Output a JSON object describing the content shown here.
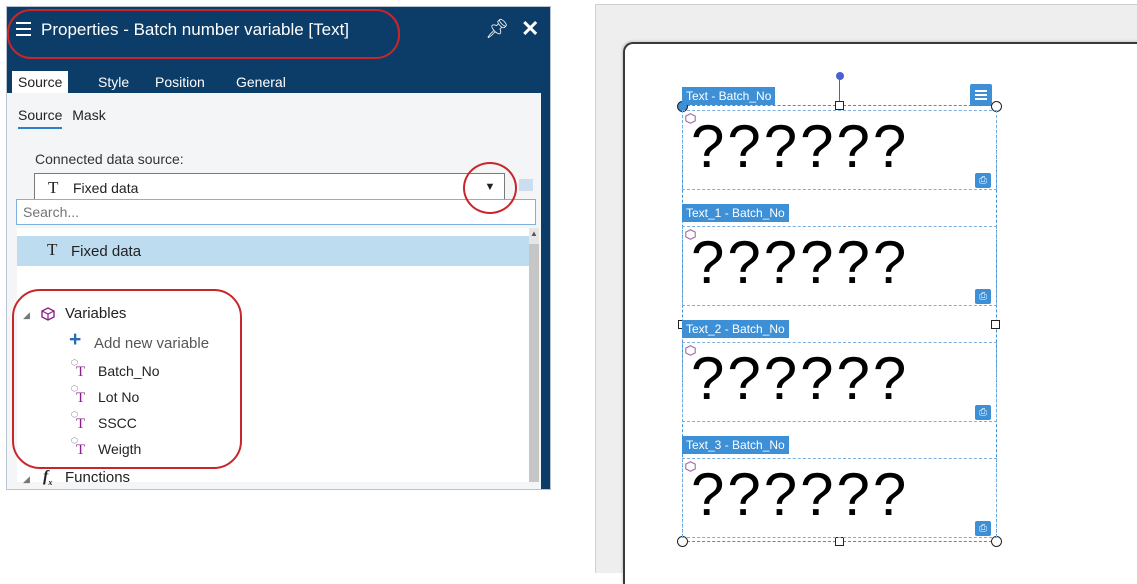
{
  "panel": {
    "title": "Properties - Batch number variable [Text]",
    "tabs": [
      {
        "label": "Source",
        "active": true
      },
      {
        "label": "Style",
        "active": false
      },
      {
        "label": "Position",
        "active": false
      },
      {
        "label": "General",
        "active": false
      }
    ],
    "subtabs": [
      {
        "label": "Source",
        "active": true
      },
      {
        "label": "Mask",
        "active": false
      }
    ],
    "connected_label": "Connected data source:",
    "selected_source": "Fixed data",
    "search_placeholder": "Search...",
    "list": {
      "selected_item": "Fixed data",
      "variables_group": "Variables",
      "add_variable": "Add new variable",
      "variables": [
        "Batch_No",
        "Lot No",
        "SSCC",
        "Weigth"
      ],
      "functions_group": "Functions"
    },
    "colors": {
      "titlebar": "#0c3c68",
      "selected_row": "#bddcef",
      "annotation": "#c8262b"
    }
  },
  "canvas": {
    "objects": [
      {
        "tag": "Text - Batch_No",
        "content": "??????"
      },
      {
        "tag": "Text_1 - Batch_No",
        "content": "??????"
      },
      {
        "tag": "Text_2 - Batch_No",
        "content": "??????"
      },
      {
        "tag": "Text_3 - Batch_No",
        "content": "??????"
      }
    ],
    "colors": {
      "selection": "#3d8fd6",
      "background": "#eeeeee"
    }
  }
}
